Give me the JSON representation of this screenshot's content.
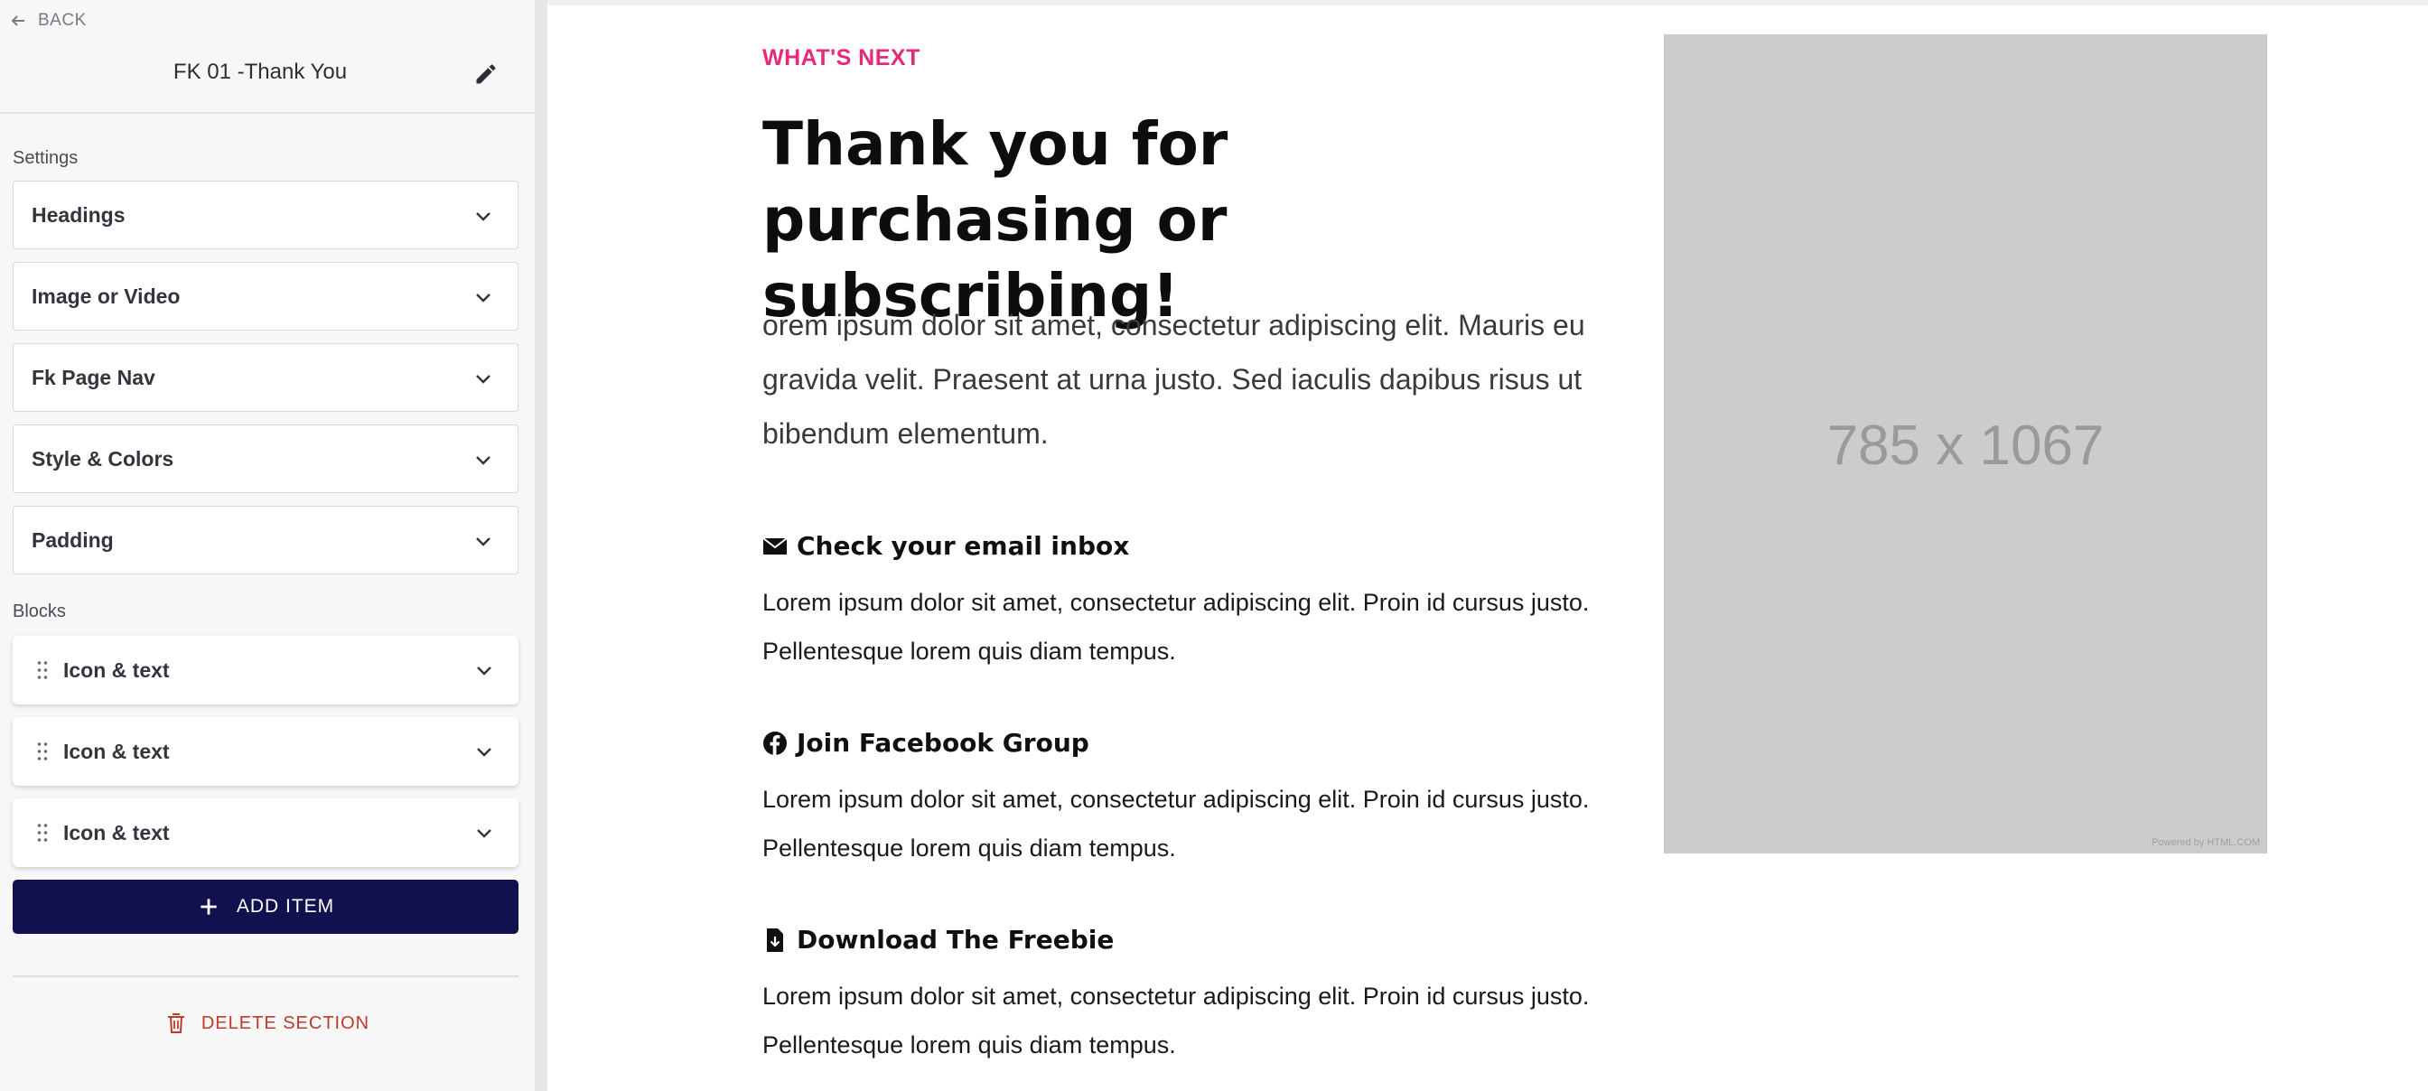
{
  "sidebar": {
    "back_label": "BACK",
    "section_name": "FK 01 -Thank You",
    "settings_label": "Settings",
    "settings": [
      {
        "label": "Headings"
      },
      {
        "label": "Image or Video"
      },
      {
        "label": "Fk Page Nav"
      },
      {
        "label": "Style & Colors"
      },
      {
        "label": "Padding"
      }
    ],
    "blocks_label": "Blocks",
    "blocks": [
      {
        "label": "Icon & text"
      },
      {
        "label": "Icon & text"
      },
      {
        "label": "Icon & text"
      }
    ],
    "add_item_label": "ADD ITEM",
    "delete_label": "DELETE SECTION"
  },
  "preview": {
    "eyebrow": "WHAT'S NEXT",
    "headline": "Thank you for purchasing or subscribing!",
    "intro": "orem ipsum dolor sit amet, consectetur adipiscing elit. Mauris eu gravida velit. Praesent at urna justo. Sed iaculis dapibus risus ut bibendum elementum.",
    "items": [
      {
        "icon": "envelope-icon",
        "title": "Check your email inbox",
        "text": "Lorem ipsum dolor sit amet, consectetur adipiscing elit. Proin id cursus justo. Pellentesque lorem quis diam tempus."
      },
      {
        "icon": "facebook-icon",
        "title": "Join Facebook Group",
        "text": "Lorem ipsum dolor sit amet, consectetur adipiscing elit. Proin id cursus justo. Pellentesque lorem quis diam tempus."
      },
      {
        "icon": "file-download-icon",
        "title": "Download The Freebie",
        "text": "Lorem ipsum dolor sit amet, consectetur adipiscing elit. Proin id cursus justo. Pellentesque lorem quis diam tempus."
      }
    ],
    "image_placeholder": {
      "dimensions": "785 x 1067",
      "powered_by": "Powered by HTML.COM"
    }
  },
  "colors": {
    "accent_pink": "#e7297a",
    "primary_button": "#121150",
    "danger": "#c0392b",
    "placeholder_bg": "#cccccc"
  }
}
